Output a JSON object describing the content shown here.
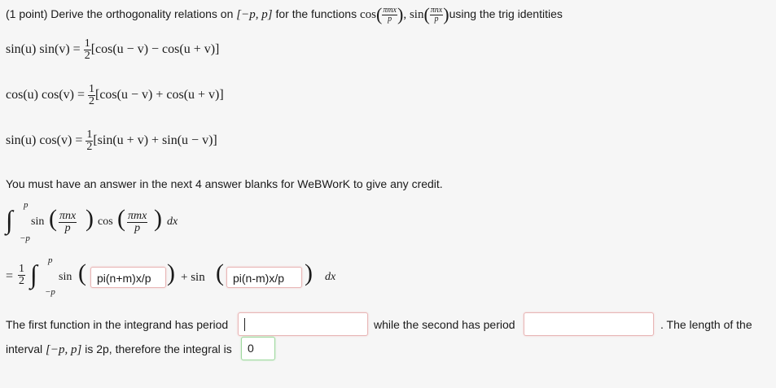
{
  "header": {
    "prefix": "(1 point) Derive the orthogonality relations on",
    "interval": "[−p, p]",
    "mid": "for the functions",
    "cos_fn": "cos",
    "sin_fn": "sin",
    "arg_m_num": "πmx",
    "arg_n_num": "πnx",
    "arg_den": "p",
    "suffix": "using the trig identities"
  },
  "identities": [
    {
      "lhs": "sin(u) sin(v) =",
      "half_num": "1",
      "half_den": "2",
      "rhs": "[cos(u − v) − cos(u + v)]"
    },
    {
      "lhs": "cos(u) cos(v) =",
      "half_num": "1",
      "half_den": "2",
      "rhs": "[cos(u − v) + cos(u + v)]"
    },
    {
      "lhs": "sin(u) cos(v) =",
      "half_num": "1",
      "half_den": "2",
      "rhs": "[sin(u + v) + sin(u − v)]"
    }
  ],
  "instruction": "You must have an answer in the next 4 answer blanks for WeBWorK to give any credit.",
  "integral": {
    "upper": "p",
    "lower": "−p",
    "sin": "sin",
    "cos": "cos",
    "arg1_num": "πnx",
    "arg2_num": "πmx",
    "den": "p",
    "dx": "dx"
  },
  "integral2": {
    "eq": "=",
    "half_num": "1",
    "half_den": "2",
    "upper": "p",
    "lower": "−p",
    "sin1": "sin",
    "plus_sin": "+ sin",
    "dx": "dx",
    "answer1_value": "pi(n+m)x/p",
    "answer2_value": "pi(n-m)x/p"
  },
  "sentence": {
    "part1": "The first function in the integrand has period",
    "part2": "while the second has period",
    "part3": ". The length of the",
    "part4_a": "interval",
    "part4_interval": "[−p, p]",
    "part4_b": "is 2p, therefore the integral is",
    "answer3_value": "",
    "answer4_value": "",
    "answer5_value": "0"
  }
}
